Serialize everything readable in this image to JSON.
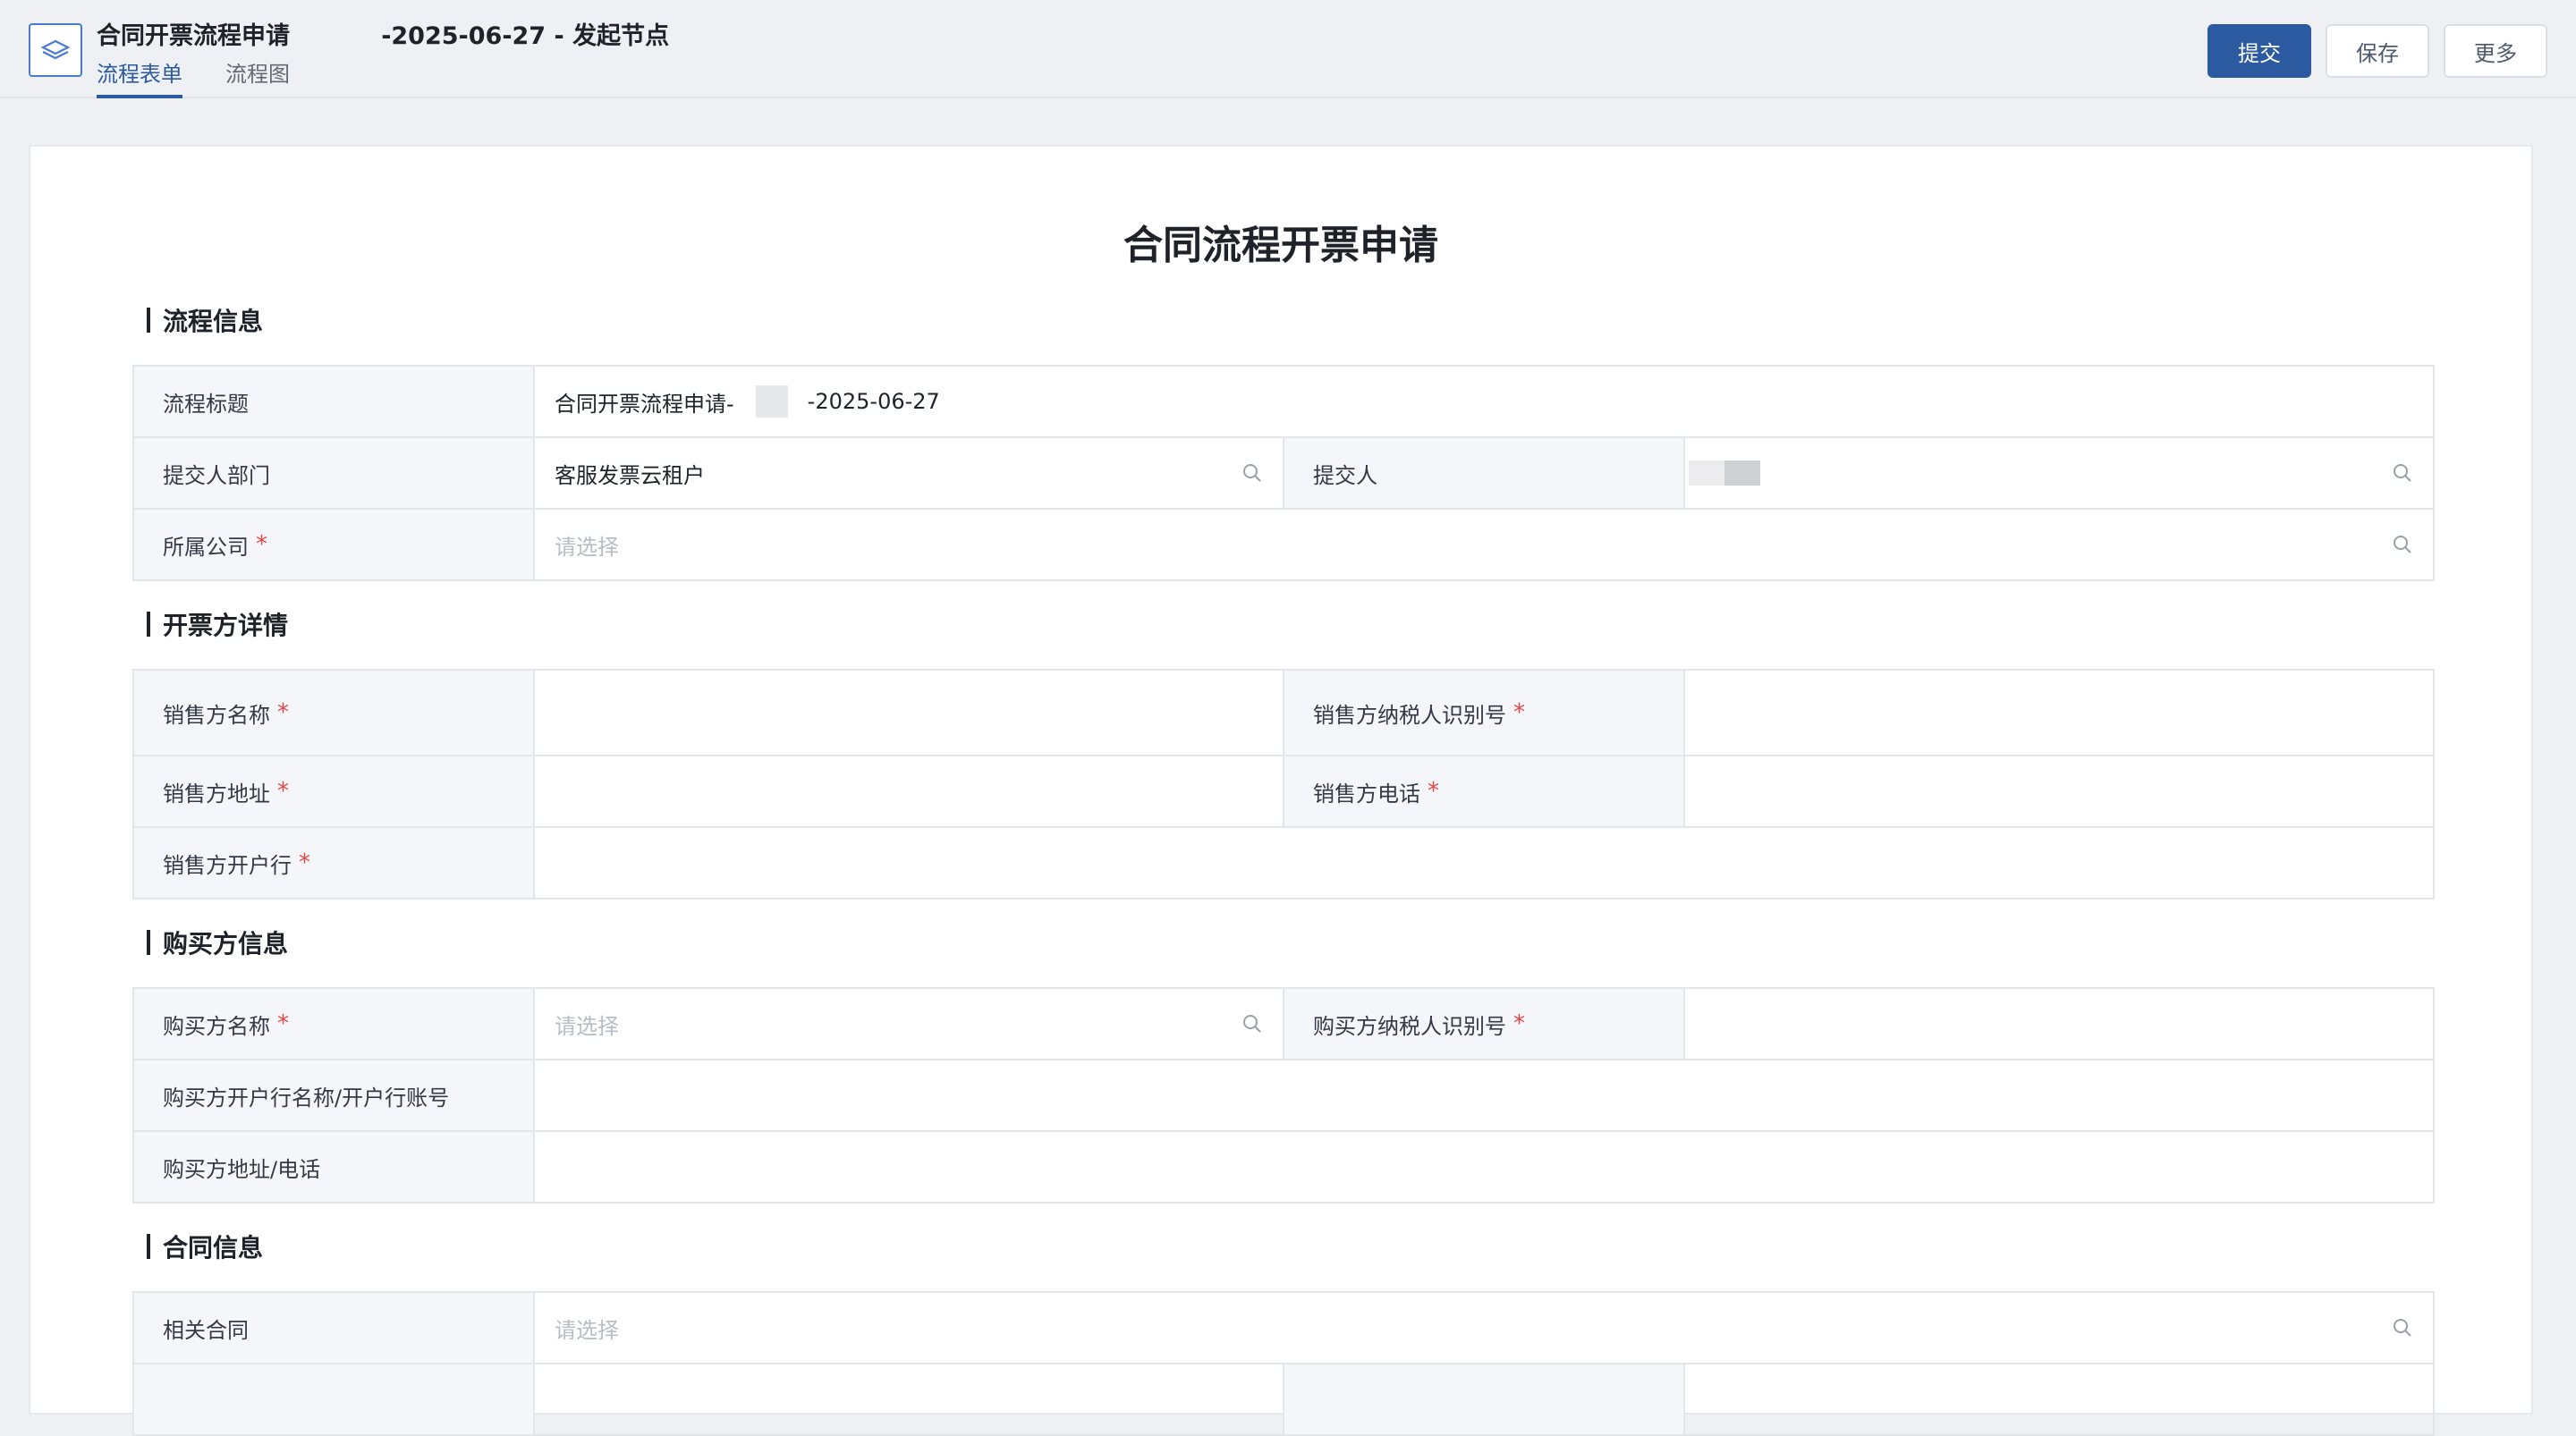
{
  "header": {
    "title": "合同开票流程申请",
    "title_suffix": "-2025-06-27 - 发起节点",
    "tabs": [
      {
        "label": "流程表单",
        "active": true
      },
      {
        "label": "流程图",
        "active": false
      }
    ],
    "buttons": {
      "submit": "提交",
      "save": "保存",
      "more": "更多"
    }
  },
  "form": {
    "title": "合同流程开票申请",
    "sections": {
      "process_info": {
        "title": "流程信息",
        "flow_title_label": "流程标题",
        "flow_title_value_prefix": "合同开票流程申请-",
        "flow_title_value_suffix": "-2025-06-27",
        "dept_label": "提交人部门",
        "dept_value": "客服发票云租户",
        "submitter_label": "提交人",
        "company_label": "所属公司",
        "company_placeholder": "请选择"
      },
      "issuer": {
        "title": "开票方详情",
        "seller_name_label": "销售方名称",
        "seller_tax_label": "销售方纳税人识别号",
        "seller_addr_label": "销售方地址",
        "seller_phone_label": "销售方电话",
        "seller_bank_label": "销售方开户行"
      },
      "buyer": {
        "title": "购买方信息",
        "buyer_name_label": "购买方名称",
        "buyer_name_placeholder": "请选择",
        "buyer_tax_label": "购买方纳税人识别号",
        "buyer_bank_label": "购买方开户行名称/开户行账号",
        "buyer_addr_label": "购买方地址/电话"
      },
      "contract": {
        "title": "合同信息",
        "related_contract_label": "相关合同",
        "related_contract_placeholder": "请选择"
      }
    },
    "required_mark": "*"
  },
  "colors": {
    "primary": "#2b5aa0",
    "required": "#e54545",
    "label_bg": "#f5f6f9"
  }
}
